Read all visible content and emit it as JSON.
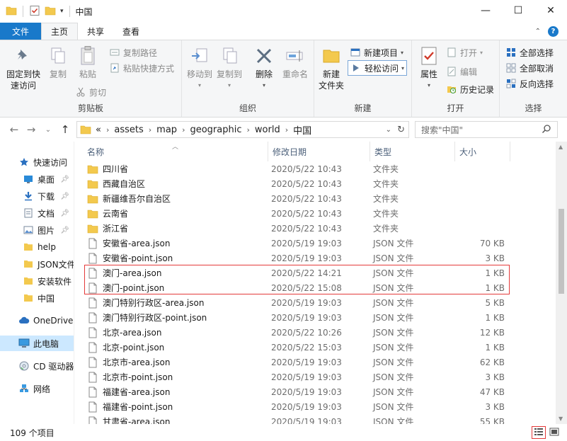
{
  "window": {
    "title": "中国",
    "minimize": "—",
    "maximize": "☐",
    "close": "✕"
  },
  "tabs": [
    {
      "label": "文件"
    },
    {
      "label": "主页"
    },
    {
      "label": "共享"
    },
    {
      "label": "查看"
    }
  ],
  "ribbon": {
    "clipboard": {
      "label": "剪贴板",
      "pin_label": "固定到快\n速访问",
      "copy_label": "复制",
      "paste_label": "粘贴",
      "copy_path_label": "复制路径",
      "paste_shortcut_label": "粘贴快捷方式",
      "cut_label": "剪切"
    },
    "organize": {
      "label": "组织",
      "move_to_label": "移动到",
      "copy_to_label": "复制到",
      "delete_label": "删除",
      "rename_label": "重命名"
    },
    "new": {
      "label": "新建",
      "new_folder_label": "新建\n文件夹",
      "new_item_label": "新建项目",
      "easy_access_label": "轻松访问"
    },
    "open": {
      "label": "打开",
      "properties_label": "属性",
      "open_label": "打开",
      "edit_label": "编辑",
      "history_label": "历史记录"
    },
    "select": {
      "label": "选择",
      "select_all_label": "全部选择",
      "select_none_label": "全部取消",
      "invert_label": "反向选择"
    }
  },
  "address": {
    "overflow": "«",
    "crumbs": [
      "assets",
      "map",
      "geographic",
      "world",
      "中国"
    ],
    "search_placeholder": "搜索\"中国\""
  },
  "nav": {
    "items": [
      {
        "label": "快速访问",
        "icon": "star-icon"
      },
      {
        "label": "桌面",
        "icon": "desktop-icon",
        "pinned": true
      },
      {
        "label": "下载",
        "icon": "download-icon",
        "pinned": true
      },
      {
        "label": "文档",
        "icon": "document-icon",
        "pinned": true
      },
      {
        "label": "图片",
        "icon": "picture-icon",
        "pinned": true
      },
      {
        "label": "help",
        "icon": "folder-icon"
      },
      {
        "label": "JSON文件",
        "icon": "folder-icon"
      },
      {
        "label": "安装软件",
        "icon": "folder-icon"
      },
      {
        "label": "中国",
        "icon": "folder-icon"
      },
      {
        "label": "OneDrive",
        "icon": "cloud-icon"
      },
      {
        "label": "此电脑",
        "icon": "computer-icon"
      },
      {
        "label": "CD 驱动器",
        "icon": "cd-icon"
      },
      {
        "label": "网络",
        "icon": "network-icon"
      }
    ]
  },
  "columns": {
    "name": "名称",
    "date": "修改日期",
    "type": "类型",
    "size": "大小"
  },
  "files": [
    {
      "name": "四川省",
      "date": "2020/5/22 10:43",
      "type": "文件夹",
      "size": "",
      "kind": "folder"
    },
    {
      "name": "西藏自治区",
      "date": "2020/5/22 10:43",
      "type": "文件夹",
      "size": "",
      "kind": "folder"
    },
    {
      "name": "新疆维吾尔自治区",
      "date": "2020/5/22 10:43",
      "type": "文件夹",
      "size": "",
      "kind": "folder"
    },
    {
      "name": "云南省",
      "date": "2020/5/22 10:43",
      "type": "文件夹",
      "size": "",
      "kind": "folder"
    },
    {
      "name": "浙江省",
      "date": "2020/5/22 10:43",
      "type": "文件夹",
      "size": "",
      "kind": "folder"
    },
    {
      "name": "安徽省-area.json",
      "date": "2020/5/19 19:03",
      "type": "JSON 文件",
      "size": "70 KB",
      "kind": "file"
    },
    {
      "name": "安徽省-point.json",
      "date": "2020/5/19 19:03",
      "type": "JSON 文件",
      "size": "3 KB",
      "kind": "file"
    },
    {
      "name": "澳门-area.json",
      "date": "2020/5/22 14:21",
      "type": "JSON 文件",
      "size": "1 KB",
      "kind": "file"
    },
    {
      "name": "澳门-point.json",
      "date": "2020/5/22 15:08",
      "type": "JSON 文件",
      "size": "1 KB",
      "kind": "file"
    },
    {
      "name": "澳门特别行政区-area.json",
      "date": "2020/5/19 19:03",
      "type": "JSON 文件",
      "size": "5 KB",
      "kind": "file"
    },
    {
      "name": "澳门特别行政区-point.json",
      "date": "2020/5/19 19:03",
      "type": "JSON 文件",
      "size": "1 KB",
      "kind": "file"
    },
    {
      "name": "北京-area.json",
      "date": "2020/5/22 10:26",
      "type": "JSON 文件",
      "size": "12 KB",
      "kind": "file"
    },
    {
      "name": "北京-point.json",
      "date": "2020/5/22 15:03",
      "type": "JSON 文件",
      "size": "1 KB",
      "kind": "file"
    },
    {
      "name": "北京市-area.json",
      "date": "2020/5/19 19:03",
      "type": "JSON 文件",
      "size": "62 KB",
      "kind": "file"
    },
    {
      "name": "北京市-point.json",
      "date": "2020/5/19 19:03",
      "type": "JSON 文件",
      "size": "3 KB",
      "kind": "file"
    },
    {
      "name": "福建省-area.json",
      "date": "2020/5/19 19:03",
      "type": "JSON 文件",
      "size": "47 KB",
      "kind": "file"
    },
    {
      "name": "福建省-point.json",
      "date": "2020/5/19 19:03",
      "type": "JSON 文件",
      "size": "3 KB",
      "kind": "file"
    },
    {
      "name": "甘肃省-area.json",
      "date": "2020/5/19 19:03",
      "type": "JSON 文件",
      "size": "55 KB",
      "kind": "file"
    }
  ],
  "status": {
    "count": "109 个项目"
  },
  "colors": {
    "accent": "#1979ca",
    "folder": "#f3c94e",
    "highlight": "#e43a3a",
    "selected": "#cce8ff"
  }
}
